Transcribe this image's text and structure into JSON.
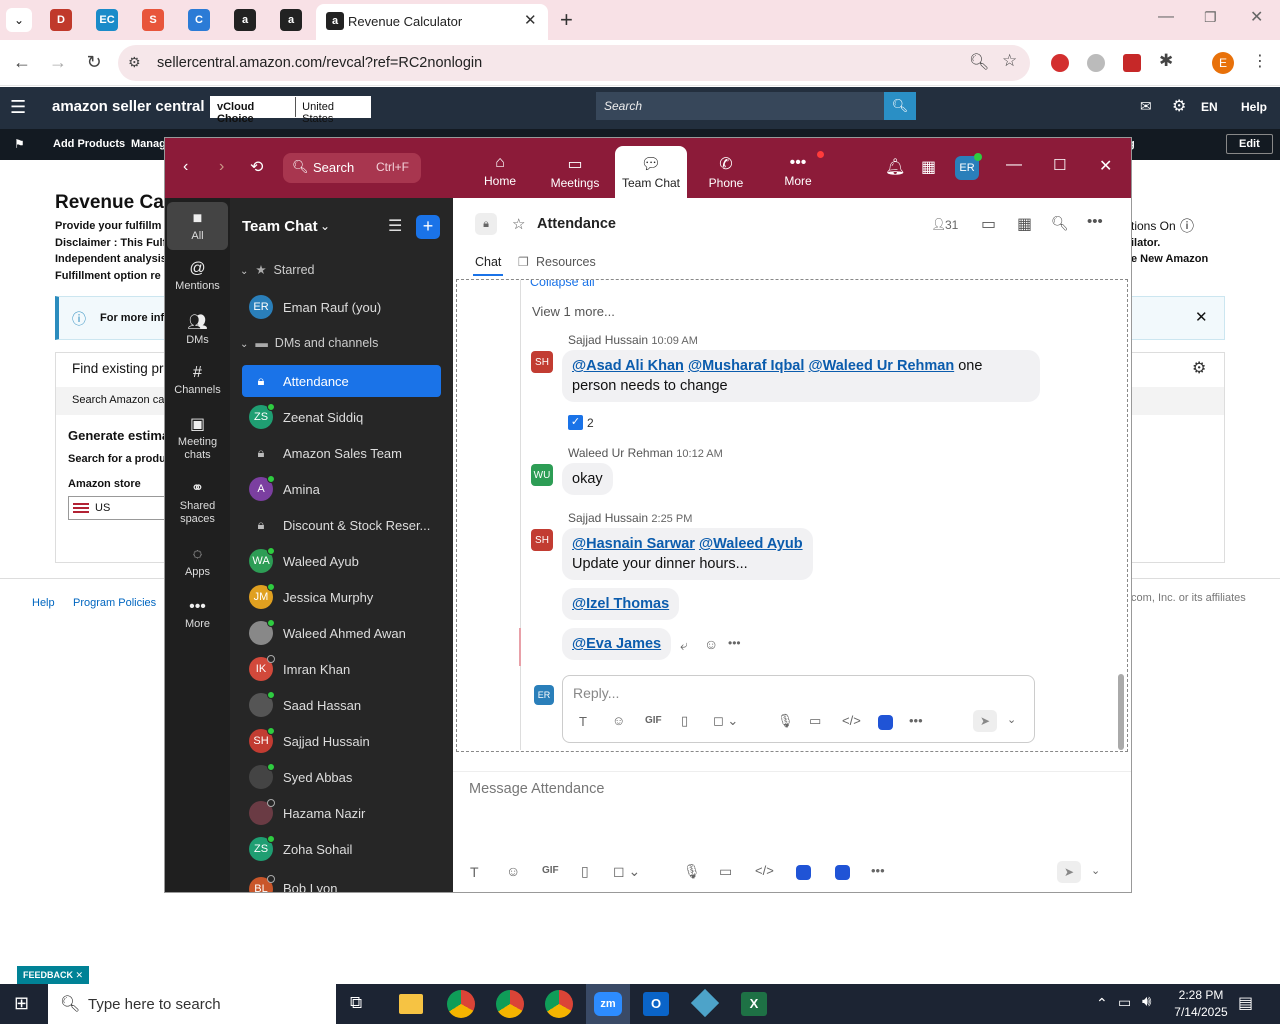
{
  "browser": {
    "tab_title": "Revenue Calculator",
    "url": "sellercentral.amazon.com/revcal?ref=RC2nonlogin",
    "new_tab": "+",
    "profile_initial": "E"
  },
  "amazon": {
    "logo": "amazon seller central",
    "badge1": "vCloud Choice",
    "badge2": "United States",
    "search_placeholder": "Search",
    "lang": "EN",
    "help": "Help",
    "nav1": "Add Products",
    "nav2": "Manage",
    "edit": "Edit",
    "title": "Revenue Cal",
    "line1": "Provide your fulfillm",
    "line2": "Disclaimer : This Fulf",
    "line3": "Independent analysis",
    "line4": "Fulfillment option re",
    "right1": "tions On",
    "right2": "ilator.",
    "right3": "e New Amazon",
    "info": "For more inf",
    "find": "Find existing pro",
    "search_amz": "Search Amazon ca",
    "gen": "Generate estima",
    "search_prod": "Search for a produ",
    "store_label": "Amazon store",
    "store_value": "US",
    "footer_help": "Help",
    "footer_policies": "Program Policies",
    "footer_right": ".com, Inc. or its affiliates",
    "feedback": "FEEDBACK"
  },
  "zoom": {
    "search": "Search",
    "shortcut": "Ctrl+F",
    "tabs": [
      {
        "label": "Home"
      },
      {
        "label": "Meetings"
      },
      {
        "label": "Team Chat"
      },
      {
        "label": "Phone"
      },
      {
        "label": "More"
      }
    ],
    "self_avatar": "ER",
    "rail": [
      {
        "label": "All"
      },
      {
        "label": "Mentions"
      },
      {
        "label": "DMs"
      },
      {
        "label": "Channels"
      },
      {
        "label": "Meeting chats"
      },
      {
        "label": "Shared spaces"
      },
      {
        "label": "Apps"
      },
      {
        "label": "More"
      }
    ],
    "sidebar_title": "Team Chat",
    "starred_header": "Starred",
    "dms_header": "DMs and channels",
    "starred": [
      {
        "initials": "ER",
        "name": "Eman Rauf (you)",
        "color": "#2a7fba"
      }
    ],
    "items": [
      {
        "initials": "",
        "name": "Attendance",
        "lock": true
      },
      {
        "initials": "ZS",
        "name": "Zeenat Siddiq",
        "color": "#1f9e72"
      },
      {
        "initials": "",
        "name": "Amazon Sales Team",
        "lock": true
      },
      {
        "initials": "A",
        "name": "Amina",
        "color": "#7b3fa0"
      },
      {
        "initials": "",
        "name": "Discount & Stock Reser...",
        "lock": true
      },
      {
        "initials": "WA",
        "name": "Waleed Ayub",
        "color": "#2d9d55"
      },
      {
        "initials": "JM",
        "name": "Jessica Murphy",
        "color": "#e0a020"
      },
      {
        "initials": "",
        "name": "Waleed Ahmed Awan",
        "color": "#888"
      },
      {
        "initials": "IK",
        "name": "Imran Khan",
        "color": "#d2493b"
      },
      {
        "initials": "",
        "name": "Saad Hassan",
        "color": "#555"
      },
      {
        "initials": "SH",
        "name": "Sajjad Hussain",
        "color": "#c23c32"
      },
      {
        "initials": "",
        "name": "Syed Abbas",
        "color": "#444"
      },
      {
        "initials": "",
        "name": "Hazama Nazir",
        "color": "#6a3b44"
      },
      {
        "initials": "ZS",
        "name": "Zoha Sohail",
        "color": "#1f9e72"
      },
      {
        "initials": "BL",
        "name": "Bob Lyon",
        "color": "#c9562a"
      }
    ],
    "channel": {
      "name": "Attendance",
      "members": "31",
      "tab_chat": "Chat",
      "tab_resources": "Resources"
    },
    "thread": {
      "collapse": "Collapse all",
      "view_more": "View 1 more...",
      "messages": [
        {
          "initials": "SH",
          "sender": "Sajjad Hussain",
          "time": "10:09 AM",
          "m1": "@Asad Ali Khan",
          "m2": "@Musharaf Iqbal",
          "m3": "@Waleed Ur Rehman",
          "text1": " one",
          "text2": "person needs to change",
          "reaction": "2"
        },
        {
          "initials": "WU",
          "sender": "Waleed Ur Rehman",
          "time": "10:12 AM",
          "text": "okay"
        },
        {
          "initials": "SH",
          "sender": "Sajjad Hussain",
          "time": "2:25 PM",
          "m1": "@Hasnain Sarwar",
          "m2": "@Waleed Ayub",
          "text": "Update your dinner hours...",
          "m3": "@Izel Thomas",
          "m4": "@Eva James"
        }
      ],
      "reply_placeholder": "Reply...",
      "reply_avatar": "ER"
    },
    "composer_placeholder": "Message Attendance"
  },
  "taskbar": {
    "search": "Type here to search",
    "time": "2:28 PM",
    "date": "7/14/2025"
  }
}
